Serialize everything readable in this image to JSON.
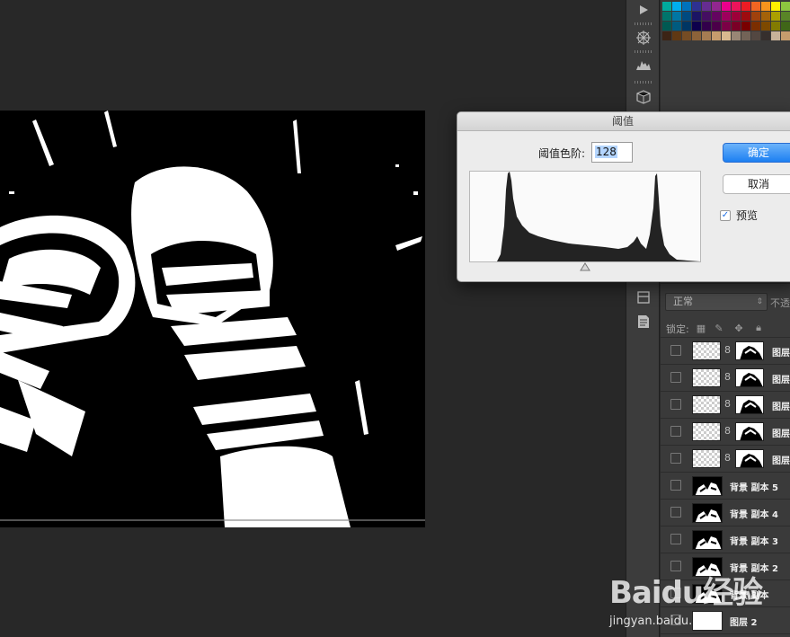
{
  "dialog": {
    "title": "阈值",
    "level_label": "阈值色阶:",
    "level_value": "128",
    "ok_label": "确定",
    "cancel_label": "取消",
    "preview_label": "预览",
    "preview_checked": true
  },
  "layers": {
    "blend_mode": "正常",
    "opacity_label": "不透",
    "lock_label": "锁定:",
    "rows": [
      {
        "name": "图层",
        "kind": "masked"
      },
      {
        "name": "图层",
        "kind": "masked"
      },
      {
        "name": "图层",
        "kind": "masked"
      },
      {
        "name": "图层",
        "kind": "masked"
      },
      {
        "name": "图层",
        "kind": "masked"
      },
      {
        "name": "背景 副本 5",
        "kind": "image"
      },
      {
        "name": "背景 副本 4",
        "kind": "image"
      },
      {
        "name": "背景 副本 3",
        "kind": "image"
      },
      {
        "name": "背景 副本 2",
        "kind": "image"
      },
      {
        "name": "背景 副本",
        "kind": "image"
      },
      {
        "name": "图层 2",
        "kind": "white"
      }
    ]
  },
  "tools": [
    "play-icon",
    "network-icon",
    "histogram-icon",
    "cube-icon",
    "layers-panel-icon",
    "notes-icon"
  ],
  "watermark": {
    "brand": "Baidu经验",
    "url": "jingyan.baidu.com"
  },
  "swatch_colors": [
    "#00a99d",
    "#00aeef",
    "#0072bc",
    "#2e3192",
    "#662d91",
    "#92278f",
    "#ec008c",
    "#ed145b",
    "#ed1c24",
    "#f26522",
    "#f7941d",
    "#fff200",
    "#8dc63f",
    "#39b54a",
    "#00746b",
    "#0076a3",
    "#004a80",
    "#1b1464",
    "#440e62",
    "#630460",
    "#9e005d",
    "#9e0039",
    "#9e0b0f",
    "#a0410d",
    "#a36209",
    "#aba000",
    "#598527",
    "#197b30",
    "#005952",
    "#005b7f",
    "#003663",
    "#0d004c",
    "#32004b",
    "#4b0049",
    "#7b0046",
    "#7a0026",
    "#790000",
    "#7b2e00",
    "#7d4900",
    "#827b00",
    "#406618",
    "#005e20",
    "#3c2415",
    "#603813",
    "#754c24",
    "#8c6239",
    "#a67c52",
    "#c69c6d",
    "#d9b98f",
    "#998675",
    "#736357",
    "#534741",
    "#362f2d",
    "#c7b299",
    "#c69c6d",
    "#a67c52"
  ]
}
